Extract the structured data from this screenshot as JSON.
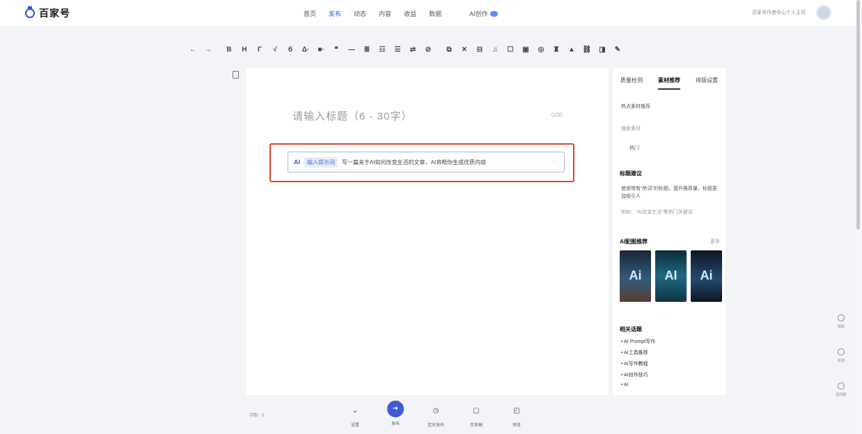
{
  "brand": {
    "name": "百家号"
  },
  "nav": {
    "items": [
      "首页",
      "发布",
      "动态",
      "内容",
      "收益",
      "数据"
    ],
    "active_index": 1,
    "ai_label": "AI创作"
  },
  "user": {
    "tag": "百家号作者中心个人主页"
  },
  "toolbar": {
    "buttons": [
      "←",
      "→",
      "B",
      "H",
      "Γ",
      "√",
      "б",
      "Δ·",
      "■·",
      "❝",
      "—",
      "≣",
      "☷",
      "☰",
      "⇄",
      "⊘",
      "⧉",
      "✕",
      "⊟",
      "♫",
      "☐",
      "▣",
      "◎",
      "♜",
      "▲",
      "⛓",
      "◨",
      "✎"
    ]
  },
  "editor": {
    "title_placeholder": "请输入标题（6 - 30字）",
    "title_count": "0/30",
    "ai_prompt": {
      "label": "AI",
      "chip": "输入提示词",
      "text": "写一篇关于AI如何改变生活的文章，AI将帮你生成优质内容",
      "arrow": "→"
    }
  },
  "panel": {
    "tabs": [
      "质量检测",
      "素材推荐",
      "排版设置"
    ],
    "active_tab": 1,
    "search_label": "热点素材推荐",
    "search_placeholder": "搜索素材",
    "hot_item": "热门",
    "tips_title": "标题建议",
    "tips_text": "使用带有\"热词\"的标题，提升推荐量，标题更加吸引人",
    "tips_note": "例如：\"AI改变生活\"等热门关键词",
    "images_title": "AI配图推荐",
    "images_more": "更多",
    "images": [
      "Ai",
      "AI",
      "Ai"
    ],
    "topics_title": "相关话题",
    "topics": [
      "AI Prompt写作",
      "AI工具推荐",
      "AI写作教程",
      "AI创作技巧",
      "AI"
    ]
  },
  "footer": {
    "word_count": "字数：0",
    "buttons": [
      {
        "icon": "⌄",
        "label": "设置"
      },
      {
        "icon": "➜",
        "label": "发布"
      },
      {
        "icon": "◷",
        "label": "定时发布"
      },
      {
        "icon": "▢",
        "label": "存草稿"
      },
      {
        "icon": "◰",
        "label": "预览"
      }
    ]
  },
  "side_float": [
    "帮助",
    "反馈",
    "回顶部"
  ]
}
